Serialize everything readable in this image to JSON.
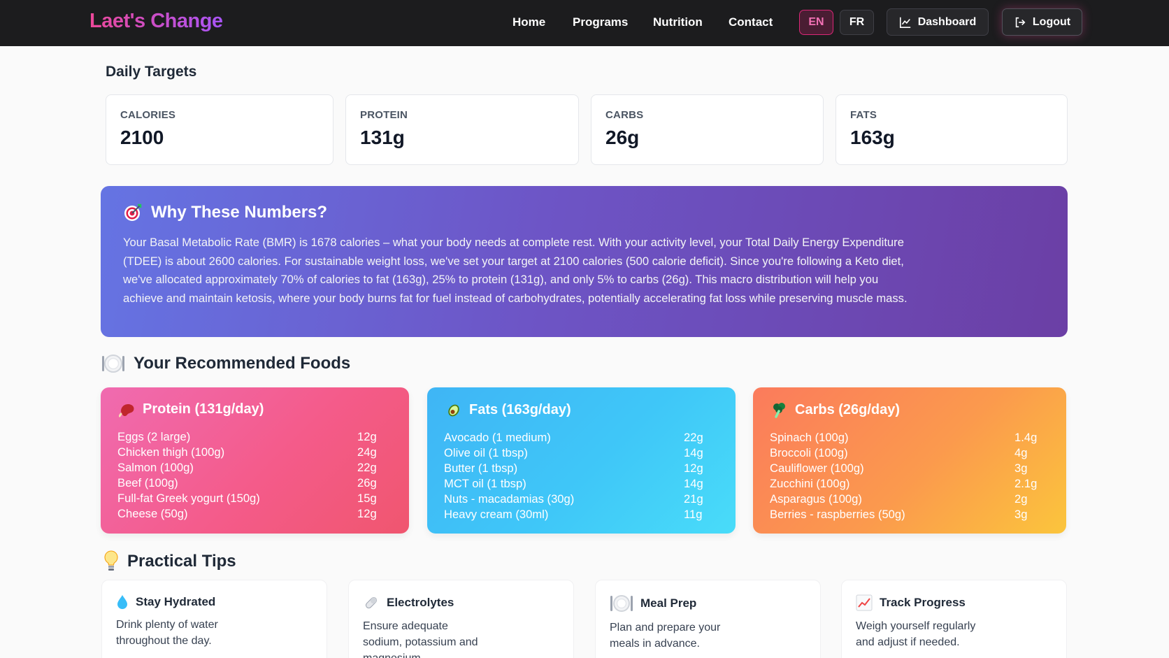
{
  "brand": "Laet's Change",
  "nav": {
    "links": [
      "Home",
      "Programs",
      "Nutrition",
      "Contact"
    ],
    "lang_en": "EN",
    "lang_fr": "FR",
    "dashboard": "Dashboard",
    "logout": "Logout",
    "active_lang": "EN"
  },
  "daily_targets": {
    "title": "Daily Targets",
    "cards": [
      {
        "label": "CALORIES",
        "value": "2100"
      },
      {
        "label": "PROTEIN",
        "value": "131g"
      },
      {
        "label": "CARBS",
        "value": "26g"
      },
      {
        "label": "FATS",
        "value": "163g"
      }
    ]
  },
  "why": {
    "title": "Why These Numbers?",
    "text": "Your Basal Metabolic Rate (BMR) is 1678 calories – what your body needs at complete rest. With your activity level, your Total Daily Energy Expenditure (TDEE) is about 2600 calories. For sustainable weight loss, we've set your target at 2100 calories (500 calorie deficit). Since you're following a Keto diet, we've allocated approximately 70% of calories to fat (163g), 25% to protein (131g), and only 5% to carbs (26g). This macro distribution will help you achieve and maintain ketosis, where your body burns fat for fuel instead of carbohydrates, potentially accelerating fat loss while preserving muscle mass."
  },
  "foods": {
    "title": "Your Recommended Foods",
    "protein": {
      "title": "Protein (131g/day)",
      "items": [
        {
          "name": "Eggs (2 large)",
          "amount": "12g"
        },
        {
          "name": "Chicken thigh (100g)",
          "amount": "24g"
        },
        {
          "name": "Salmon (100g)",
          "amount": "22g"
        },
        {
          "name": "Beef (100g)",
          "amount": "26g"
        },
        {
          "name": "Full-fat Greek yogurt (150g)",
          "amount": "15g"
        },
        {
          "name": "Cheese (50g)",
          "amount": "12g"
        }
      ]
    },
    "fats": {
      "title": "Fats (163g/day)",
      "items": [
        {
          "name": "Avocado (1 medium)",
          "amount": "22g"
        },
        {
          "name": "Olive oil (1 tbsp)",
          "amount": "14g"
        },
        {
          "name": "Butter (1 tbsp)",
          "amount": "12g"
        },
        {
          "name": "MCT oil (1 tbsp)",
          "amount": "14g"
        },
        {
          "name": "Nuts - macadamias (30g)",
          "amount": "21g"
        },
        {
          "name": "Heavy cream (30ml)",
          "amount": "11g"
        }
      ]
    },
    "carbs": {
      "title": "Carbs (26g/day)",
      "items": [
        {
          "name": "Spinach (100g)",
          "amount": "1.4g"
        },
        {
          "name": "Broccoli (100g)",
          "amount": "4g"
        },
        {
          "name": "Cauliflower (100g)",
          "amount": "3g"
        },
        {
          "name": "Zucchini (100g)",
          "amount": "2.1g"
        },
        {
          "name": "Asparagus (100g)",
          "amount": "2g"
        },
        {
          "name": "Berries - raspberries (50g)",
          "amount": "3g"
        }
      ]
    }
  },
  "tips": {
    "title": "Practical Tips",
    "cards": [
      {
        "title": "Stay Hydrated",
        "text": "Drink plenty of water throughout the day.",
        "icon": "droplet-icon"
      },
      {
        "title": "Electrolytes",
        "text": "Ensure adequate sodium, potassium and magnesium.",
        "icon": "pill-icon"
      },
      {
        "title": "Meal Prep",
        "text": "Plan and prepare your meals in advance.",
        "icon": "plate-icon"
      },
      {
        "title": "Track Progress",
        "text": "Weigh yourself regularly and adjust if needed.",
        "icon": "chart-icon"
      }
    ]
  },
  "colors": {
    "brand_start": "#ec4899",
    "brand_end": "#a855f7",
    "nav_bg": "#1c1c1e",
    "why_start": "#6574e3",
    "why_end": "#6b3fa5",
    "protein_start": "#f06bb0",
    "protein_end": "#f0566f",
    "fats_start": "#3fb5f5",
    "fats_end": "#49dcf9",
    "carbs_start": "#fb7b5c",
    "carbs_end": "#fbc53c"
  }
}
